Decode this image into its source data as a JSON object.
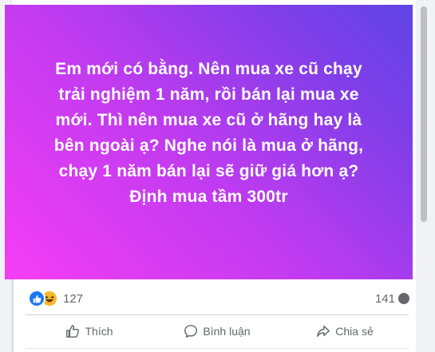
{
  "post": {
    "background_gradient": [
      "#f53df5",
      "#c03bf0",
      "#7e3ee8",
      "#5f45e6"
    ],
    "lines": [
      "Em mới có bằng. Nên mua xe cũ chạy",
      "trải nghiệm 1 năm, rồi bán lại mua xe",
      "mới. Thì nên mua xe cũ ở hãng hay là",
      "bên ngoài ạ? Nghe nói là mua ở hãng,",
      "chạy 1 năm bán lại sẽ giữ giá hơn ạ?",
      "Định mua tầm 300tr"
    ]
  },
  "stats": {
    "reaction_icons": [
      "like-icon",
      "haha-icon"
    ],
    "reaction_count": "127",
    "comment_count": "141"
  },
  "actions": {
    "like_label": "Thích",
    "comment_label": "Bình luận",
    "share_label": "Chia sẻ"
  },
  "colors": {
    "like_blue": "#1877f2",
    "haha_yellow": "#f7b928",
    "secondary_text": "#65676b"
  }
}
